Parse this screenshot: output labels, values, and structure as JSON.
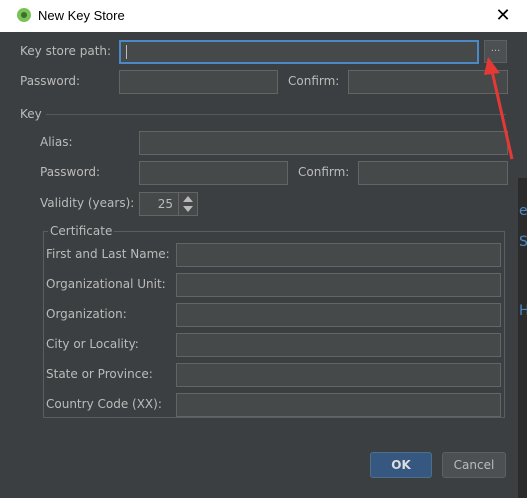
{
  "window": {
    "title": "New Key Store",
    "close_glyph": "✕"
  },
  "keystore": {
    "path_label": "Key store path:",
    "path_value": "",
    "browse_label": "...",
    "password_label": "Password:",
    "confirm_label": "Confirm:"
  },
  "key": {
    "section_label": "Key",
    "alias_label": "Alias:",
    "password_label": "Password:",
    "confirm_label": "Confirm:",
    "validity_label": "Validity (years):",
    "validity_value": "25"
  },
  "certificate": {
    "title": "Certificate",
    "fields": [
      {
        "label": "First and Last Name:"
      },
      {
        "label": "Organizational Unit:"
      },
      {
        "label": "Organization:"
      },
      {
        "label": "City or Locality:"
      },
      {
        "label": "State or Province:"
      },
      {
        "label": "Country Code (XX):"
      }
    ]
  },
  "buttons": {
    "ok": "OK",
    "cancel": "Cancel"
  },
  "background_glyphs": [
    "e",
    "S",
    "H"
  ],
  "colors": {
    "annotation_arrow": "#e53935",
    "focus_border": "#4a88c7",
    "dialog_background": "#3c3f41"
  },
  "icons": {
    "app": "android-studio-icon",
    "close": "close-icon"
  }
}
